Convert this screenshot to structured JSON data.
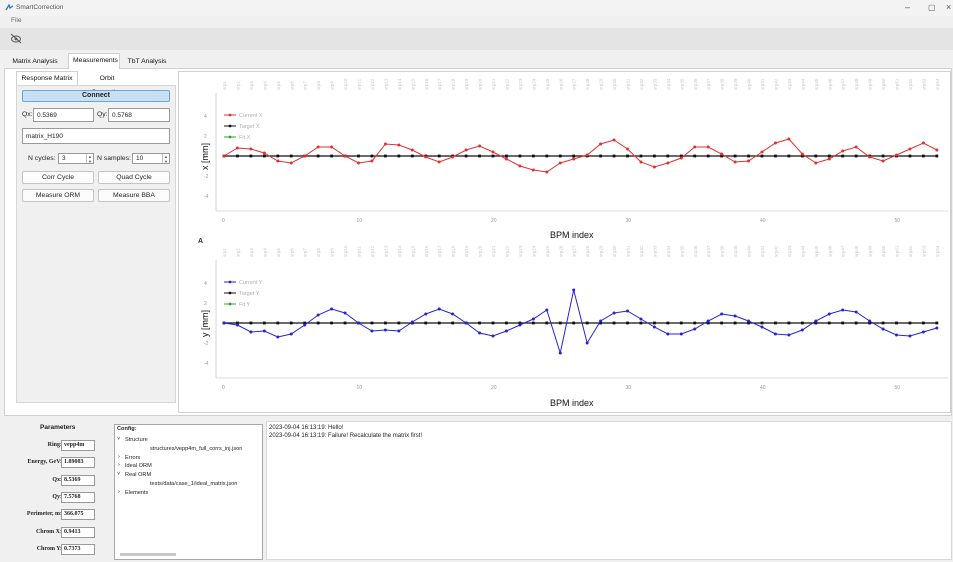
{
  "window": {
    "title": "SmartCorrection",
    "menu_file": "File",
    "min": "–",
    "max": "▢",
    "close": "×"
  },
  "tabs": [
    "Matrix Analysis",
    "Measurements",
    "TbT Analysis"
  ],
  "subtabs": [
    "Response Matrix",
    "Orbit Correction"
  ],
  "controls": {
    "connect": "Connect",
    "qx_label": "Qx:",
    "qx_value": "0.5369",
    "qy_label": "Qy:",
    "qy_value": "0.5768",
    "name_value": "matrix_H190",
    "ncycles_label": "N cycles:",
    "ncycles_value": "3",
    "nsamples_label": "N samples:",
    "nsamples_value": "10",
    "corr_cycle": "Corr Cycle",
    "quad_cycle": "Quad Cycle",
    "measure_orm": "Measure ORM",
    "measure_bba": "Measure BBA"
  },
  "plots": {
    "a_marker": "A",
    "bpm_names": [
      "srp1",
      "srp2",
      "srp3",
      "srp4",
      "srp5",
      "srp6",
      "srp7",
      "srp8",
      "srp9",
      "srp10",
      "srp11",
      "srp12",
      "srp13",
      "srp14",
      "srp15",
      "srp16",
      "srp17",
      "srp18",
      "srp19",
      "srp20",
      "srp21",
      "srp22",
      "srp23",
      "srp24",
      "srp25",
      "srp26",
      "srp27",
      "srp28",
      "srp29",
      "srp30",
      "srp31",
      "srp32",
      "srp33",
      "srp34",
      "srp35",
      "srp36",
      "srp37",
      "srp38",
      "srp39",
      "srp40",
      "srp41",
      "srp42",
      "srp43",
      "srp44",
      "srp45",
      "srp46",
      "srp47",
      "srp48",
      "srp49",
      "srp50",
      "srp51",
      "srp52",
      "srp53",
      "srp54"
    ],
    "x_ticks": [
      0,
      10,
      20,
      30,
      40,
      50
    ],
    "y_ticks": [
      4,
      2,
      0,
      -2,
      -4
    ],
    "xlabel": "BPM index",
    "top": {
      "ylabel": "x [mm]",
      "legend": [
        "Current X",
        "Target X",
        "Fit X"
      ],
      "colors": [
        "#e53030",
        "#111111",
        "#2ca02c"
      ],
      "current": [
        0,
        0.8,
        0.7,
        0.3,
        -0.5,
        -0.7,
        0,
        0.9,
        0.9,
        0,
        -0.7,
        -0.5,
        1.2,
        1.1,
        0.6,
        -0.1,
        -0.6,
        -0.1,
        0.6,
        1.0,
        0.4,
        -0.3,
        -1.0,
        -1.4,
        -1.6,
        -0.7,
        -0.3,
        0.1,
        1.2,
        1.6,
        0.7,
        -0.6,
        -1.1,
        -0.7,
        -0.2,
        0.9,
        0.9,
        0.2,
        -0.6,
        -0.5,
        0.4,
        1.3,
        1.7,
        0.2,
        -0.7,
        -0.3,
        0.5,
        0.9,
        -0.1,
        -0.5,
        0.1,
        0.7,
        1.3,
        0.6
      ]
    },
    "bottom": {
      "ylabel": "y [mm]",
      "legend": [
        "Current Y",
        "Target Y",
        "Fit Y"
      ],
      "colors": [
        "#2525d8",
        "#111111",
        "#2ca02c"
      ],
      "current": [
        0,
        -0.2,
        -0.9,
        -0.8,
        -1.4,
        -1.1,
        -0.2,
        0.8,
        1.4,
        1.0,
        0,
        -0.8,
        -0.7,
        -0.8,
        0.1,
        0.9,
        1.4,
        0.9,
        0,
        -1.0,
        -1.3,
        -0.8,
        -0.2,
        0.4,
        1.3,
        -3.0,
        3.3,
        -2.0,
        0.2,
        1.0,
        1.2,
        0.4,
        -0.4,
        -1.1,
        -1.1,
        -0.6,
        0.2,
        0.9,
        0.7,
        0.2,
        -0.4,
        -1.1,
        -1.2,
        -0.7,
        0.2,
        0.9,
        1.3,
        1.1,
        0.2,
        -0.6,
        -1.2,
        -1.3,
        -0.9,
        -0.5
      ]
    }
  },
  "parameters": {
    "title": "Parameters",
    "rows": [
      {
        "label": "Ring:",
        "value": "vepp4m"
      },
      {
        "label": "Energy, GeV:",
        "value": "1.89083"
      },
      {
        "label": "Qx:",
        "value": "8.5369"
      },
      {
        "label": "Qy:",
        "value": "7.5768"
      },
      {
        "label": "Perimeter, m:",
        "value": "366.075"
      },
      {
        "label": "Chrom X:",
        "value": "0.9413"
      },
      {
        "label": "Chrom Y:",
        "value": "0.7373"
      }
    ]
  },
  "config": {
    "title": "Config:",
    "structure": "Structure",
    "structure_path": "structures/vepp4m_full_corrs_inj.json",
    "errors": "Errors",
    "ideal_orm": "Ideal ORM",
    "real_orm": "Real ORM",
    "real_orm_path": "tests/data/case_1/ideal_matrix.json",
    "elements": "Elements"
  },
  "log": [
    "2023-09-04 16:13:19: Hello!",
    "2023-09-04 16:13:19: Failure! Recalculate the matrix first!"
  ]
}
